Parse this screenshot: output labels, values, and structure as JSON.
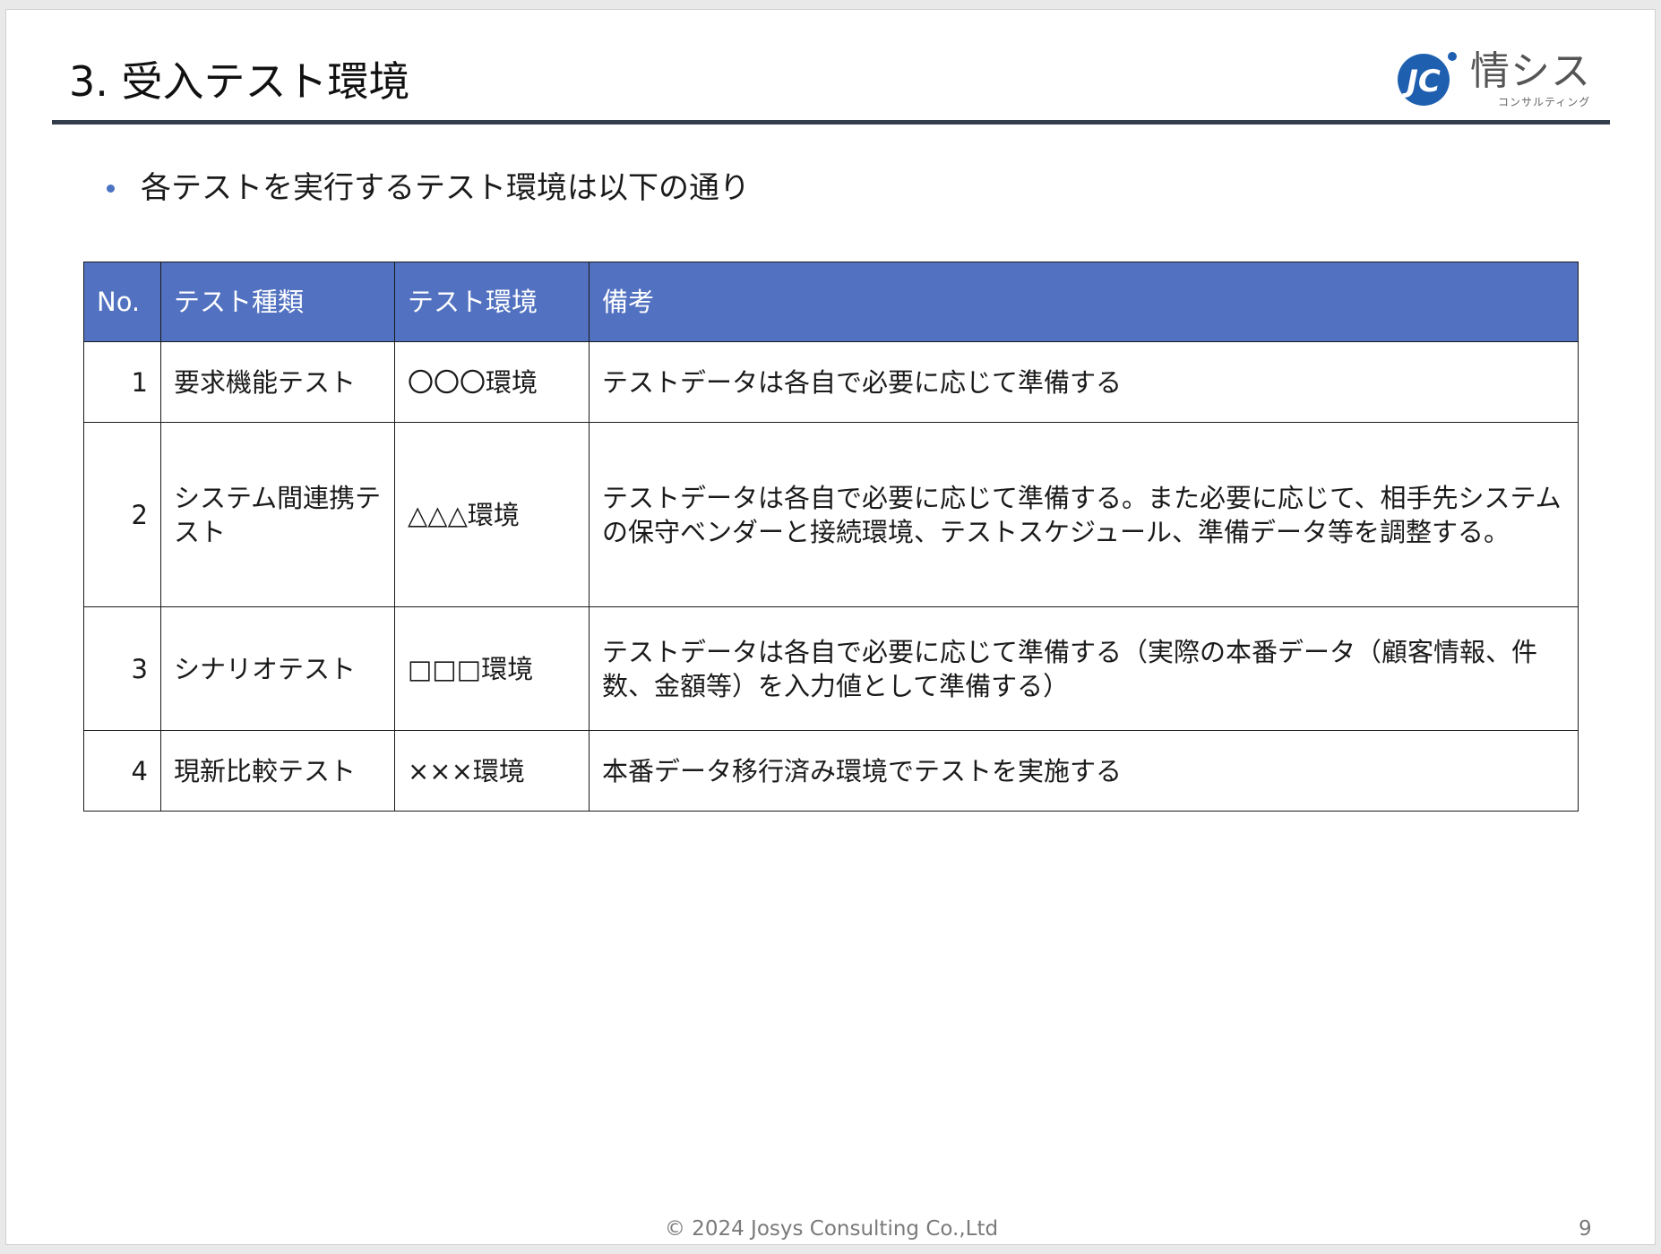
{
  "slide": {
    "title": "3. 受入テスト環境",
    "bullet": "各テストを実行するテスト環境は以下の通り",
    "footer": "© 2024 Josys Consulting Co.,Ltd",
    "page_number": "9"
  },
  "logo": {
    "text": "情シス",
    "subtext": "コンサルティング",
    "mark_letters": "JC",
    "mark_icon": "jc-circle-logo-icon",
    "colors": {
      "mark": "#1f5fb0",
      "text": "#555555"
    }
  },
  "table": {
    "headers": [
      "No.",
      "テスト種類",
      "テスト環境",
      "備考"
    ],
    "rows": [
      {
        "no": "1",
        "type": "要求機能テスト",
        "env": "〇〇〇環境",
        "note": "テストデータは各自で必要に応じて準備する"
      },
      {
        "no": "2",
        "type": "システム間連携テスト",
        "env": "△△△環境",
        "note": "テストデータは各自で必要に応じて準備する。また必要に応じて、相手先システムの保守ベンダーと接続環境、テストスケジュール、準備データ等を調整する。"
      },
      {
        "no": "3",
        "type": "シナリオテスト",
        "env": "□□□環境",
        "note": "テストデータは各自で必要に応じて準備する（実際の本番データ（顧客情報、件数、金額等）を入力値として準備する）"
      },
      {
        "no": "4",
        "type": "現新比較テスト",
        "env": "×××環境",
        "note": "本番データ移行済み環境でテストを実施する"
      }
    ]
  },
  "colors": {
    "header_bg": "#5272c1",
    "title_rule": "#333d4c",
    "bullet": "#4a73c2"
  }
}
